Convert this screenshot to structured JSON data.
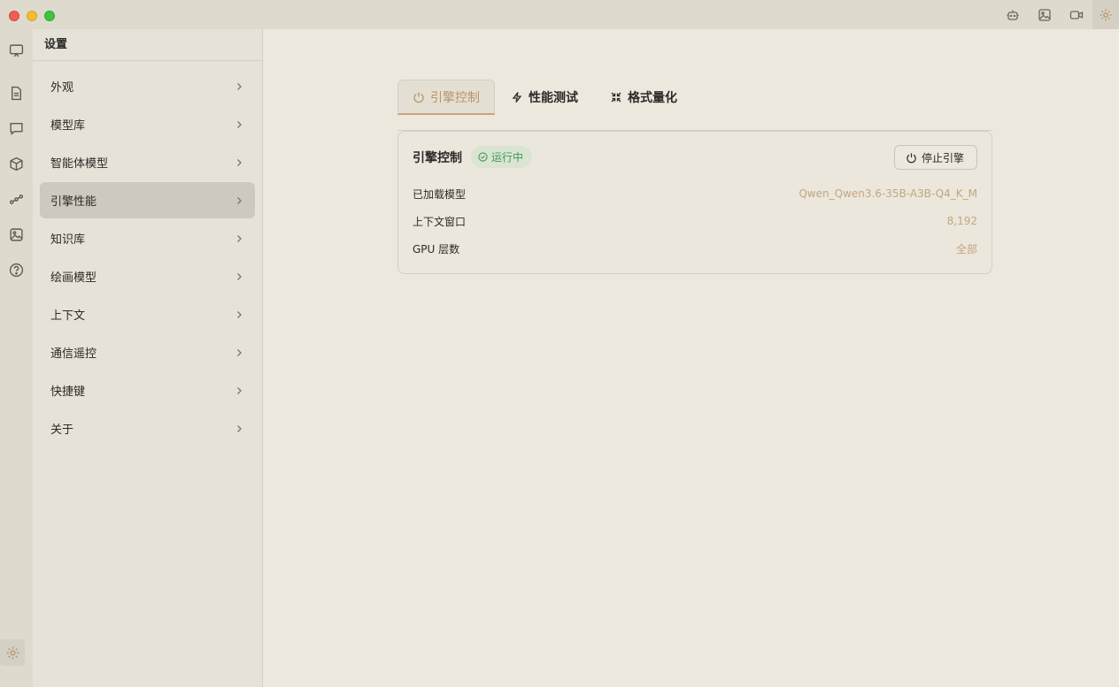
{
  "window": {
    "top_icons": [
      "robot-icon",
      "image-icon",
      "video-icon",
      "gear-icon"
    ]
  },
  "rail": {
    "icons": [
      "presentation-icon",
      "document-icon",
      "chat-icon",
      "cube-icon",
      "workflow-icon",
      "image-icon",
      "help-icon"
    ],
    "bottom_icon": "gear-icon"
  },
  "sidebar": {
    "title": "设置",
    "items": [
      {
        "label": "外观"
      },
      {
        "label": "模型库"
      },
      {
        "label": "智能体模型"
      },
      {
        "label": "引擎性能"
      },
      {
        "label": "知识库"
      },
      {
        "label": "绘画模型"
      },
      {
        "label": "上下文"
      },
      {
        "label": "通信遥控"
      },
      {
        "label": "快捷键"
      },
      {
        "label": "关于"
      }
    ],
    "active_index": 3
  },
  "main": {
    "tabs": [
      {
        "label": "引擎控制",
        "icon": "power-icon"
      },
      {
        "label": "性能测试",
        "icon": "bolt-icon"
      },
      {
        "label": "格式量化",
        "icon": "compress-icon"
      }
    ],
    "card": {
      "title": "引擎控制",
      "status": "运行中",
      "stop_label": "停止引擎",
      "rows": [
        {
          "label": "已加载模型",
          "value": "Qwen_Qwen3.6-35B-A3B-Q4_K_M"
        },
        {
          "label": "上下文窗口",
          "value": "8,192"
        },
        {
          "label": "GPU 层数",
          "value": "全部"
        }
      ]
    }
  },
  "colors": {
    "accent": "#b8956a",
    "status_green": "#3f9a55",
    "background": "#ece8dd"
  }
}
